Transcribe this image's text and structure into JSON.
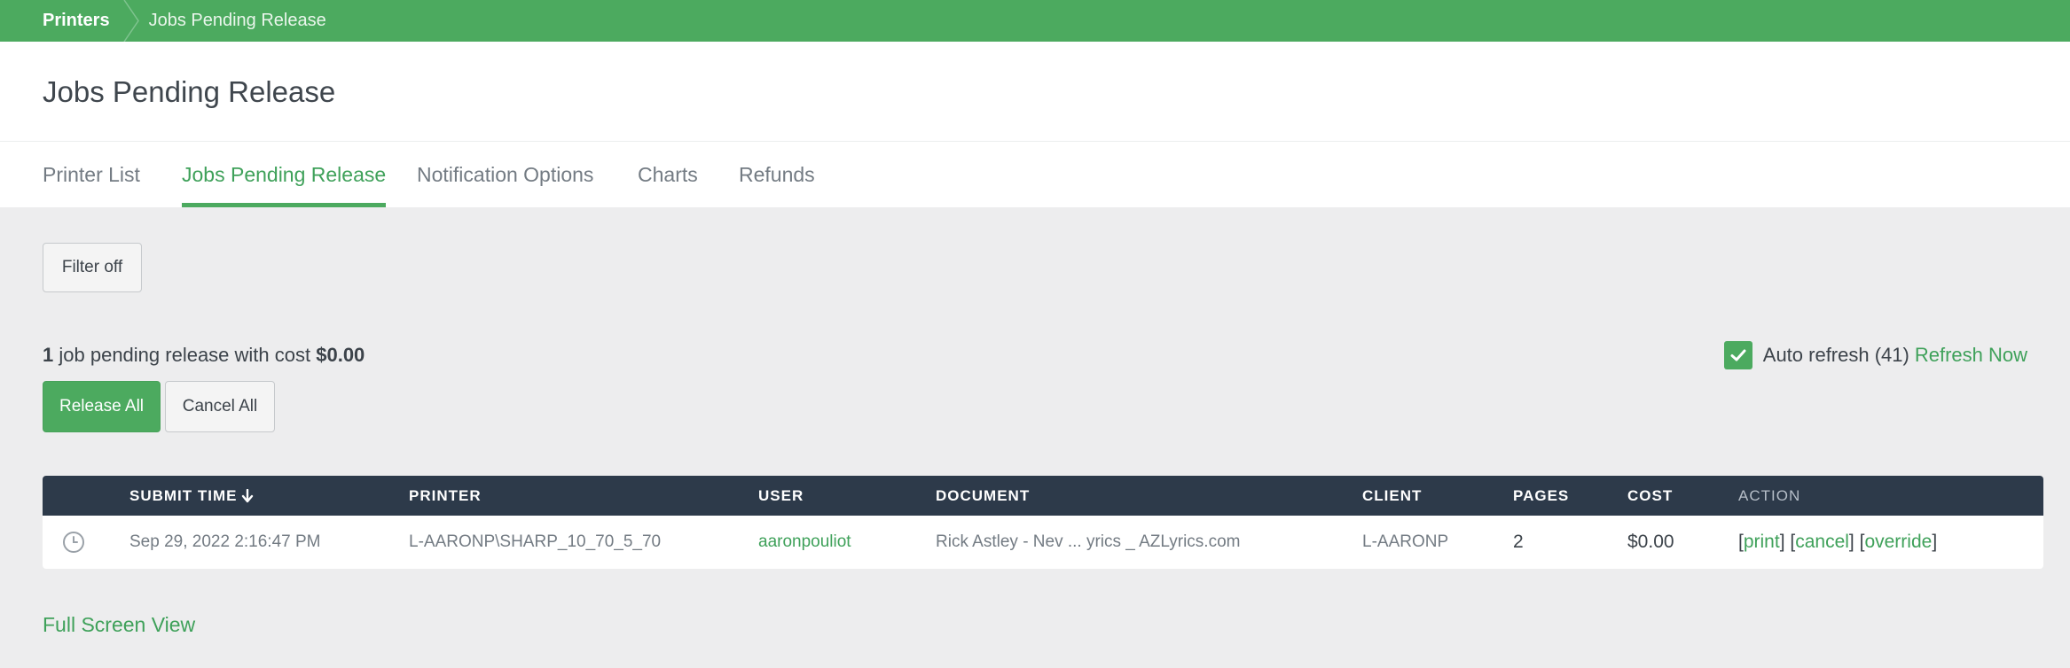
{
  "breadcrumb": {
    "root": "Printers",
    "current": "Jobs Pending Release"
  },
  "page": {
    "title": "Jobs Pending Release"
  },
  "tabs": [
    {
      "label": "Printer List",
      "active": false
    },
    {
      "label": "Jobs Pending Release",
      "active": true
    },
    {
      "label": "Notification Options",
      "active": false
    },
    {
      "label": "Charts",
      "active": false
    },
    {
      "label": "Refunds",
      "active": false
    }
  ],
  "filter": {
    "button_label": "Filter off"
  },
  "summary": {
    "count": "1",
    "text": "job pending release with cost",
    "cost": "$0.00"
  },
  "auto_refresh": {
    "checked": true,
    "label": "Auto refresh (41)",
    "refresh_now": "Refresh Now"
  },
  "actions": {
    "release_all": "Release All",
    "cancel_all": "Cancel All"
  },
  "table": {
    "headers": {
      "submit_time": "SUBMIT TIME",
      "printer": "PRINTER",
      "user": "USER",
      "document": "DOCUMENT",
      "client": "CLIENT",
      "pages": "PAGES",
      "cost": "COST",
      "action": "ACTION"
    },
    "rows": [
      {
        "submit_time": "Sep 29, 2022 2:16:47 PM",
        "printer": "L-AARONP\\SHARP_10_70_5_70",
        "user": "aaronpouliot",
        "document": "Rick Astley - Nev ... yrics _ AZLyrics.com",
        "client": "L-AARONP",
        "pages": "2",
        "cost": "$0.00",
        "action_print": "print",
        "action_cancel": "cancel",
        "action_override": "override"
      }
    ]
  },
  "footer": {
    "full_screen": "Full Screen View"
  },
  "colors": {
    "accent": "#4caa5f",
    "header_dark": "#2d3a4a",
    "background": "#ededee"
  }
}
